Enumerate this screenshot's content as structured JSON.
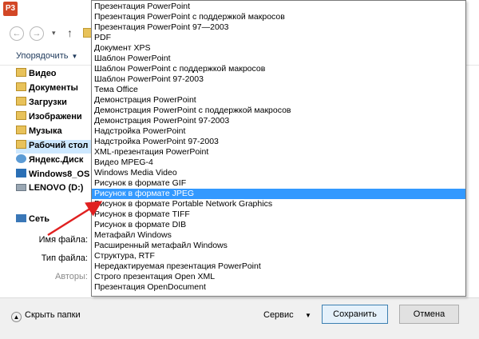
{
  "titlebar": {
    "app_icon_text": "P3",
    "close_glyph": "✕"
  },
  "navigation": {
    "back_glyph": "←",
    "forward_glyph": "→",
    "dropdown_glyph": "▾",
    "up_glyph": "↑"
  },
  "toolbar": {
    "organize_label": "Упорядочить",
    "organize_caret": "▼"
  },
  "nav_pane": {
    "items": [
      {
        "label": "Видео",
        "icon": "folder-icon"
      },
      {
        "label": "Документы",
        "icon": "folder-icon"
      },
      {
        "label": "Загрузки",
        "icon": "folder-icon"
      },
      {
        "label": "Изображени",
        "icon": "folder-icon"
      },
      {
        "label": "Музыка",
        "icon": "folder-icon"
      },
      {
        "label": "Рабочий стол",
        "icon": "folder-icon"
      },
      {
        "label": "Яндекс.Диск",
        "icon": "yandex-disk-icon"
      },
      {
        "label": "Windows8_OS",
        "icon": "windows-drive-icon"
      },
      {
        "label": "LENOVO (D:)",
        "icon": "drive-icon"
      }
    ],
    "network_label": "Сеть"
  },
  "form": {
    "filename_label": "Имя файла:",
    "filetype_label": "Тип файла:",
    "authors_label": "Авторы:"
  },
  "file_types": {
    "selected_index": 18,
    "items": [
      "Презентация PowerPoint",
      "Презентация PowerPoint с поддержкой макросов",
      "Презентация PowerPoint 97—2003",
      "PDF",
      "Документ XPS",
      "Шаблон PowerPoint",
      "Шаблон PowerPoint с поддержкой макросов",
      "Шаблон PowerPoint 97-2003",
      "Тема Office",
      "Демонстрация PowerPoint",
      "Демонстрация PowerPoint с поддержкой макросов",
      "Демонстрация PowerPoint 97-2003",
      "Надстройка PowerPoint",
      "Надстройка PowerPoint 97-2003",
      "XML-презентация PowerPoint",
      "Видео MPEG-4",
      "Windows Media Video",
      "Рисунок в формате GIF",
      "Рисунок в формате JPEG",
      "Рисунок в формате Portable Network Graphics",
      "Рисунок в формате TIFF",
      "Рисунок в формате DIB",
      "Метафайл Windows",
      "Расширенный метафайл Windows",
      "Структура, RTF",
      "Нередактируемая презентация PowerPoint",
      "Строго презентация Open XML",
      "Презентация OpenDocument"
    ]
  },
  "footer": {
    "hide_folders_label": "Скрыть папки",
    "hide_folders_glyph": "▲",
    "service_label": "Сервис",
    "service_caret": "▼",
    "save_label": "Сохранить",
    "cancel_label": "Отмена"
  },
  "colors": {
    "selection": "#3399ff",
    "arrow": "#e02020"
  }
}
